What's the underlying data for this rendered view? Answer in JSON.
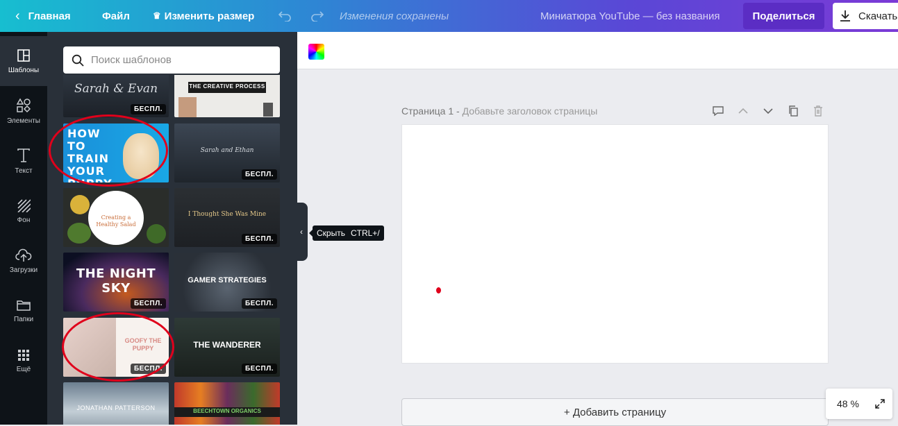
{
  "topbar": {
    "home": "Главная",
    "file": "Файл",
    "resize": "Изменить размер",
    "saved_status": "Изменения сохранены",
    "doc_title": "Миниатюра YouTube — без названия",
    "share": "Поделиться",
    "download": "Скачать"
  },
  "nav": {
    "items": [
      {
        "label": "Шаблоны",
        "icon": "templates-icon"
      },
      {
        "label": "Элементы",
        "icon": "elements-icon"
      },
      {
        "label": "Текст",
        "icon": "text-icon"
      },
      {
        "label": "Фон",
        "icon": "background-icon"
      },
      {
        "label": "Загрузки",
        "icon": "uploads-icon"
      },
      {
        "label": "Папки",
        "icon": "folder-icon"
      },
      {
        "label": "Ещё",
        "icon": "more-icon"
      }
    ]
  },
  "panel": {
    "search_placeholder": "Поиск шаблонов",
    "badge": "БЕСПЛ.",
    "templates": [
      {
        "title": "Sarah & Evan"
      },
      {
        "title": "THE CREATIVE PROCESS"
      },
      {
        "title": "HOW TO TRAIN YOUR PUPPY"
      },
      {
        "title": "Sarah and Ethan"
      },
      {
        "title": "Creating a Healthy Salad"
      },
      {
        "title": "I Thought She Was Mine"
      },
      {
        "title": "THE NIGHT SKY"
      },
      {
        "title": "GAMER STRATEGIES"
      },
      {
        "title": "GOOFY THE PUPPY"
      },
      {
        "title": "THE WANDERER"
      },
      {
        "title": "JONATHAN PATTERSON"
      },
      {
        "title": "BEECHTOWN ORGANICS"
      }
    ]
  },
  "collapse_tooltip": {
    "label": "Скрыть",
    "shortcut": "CTRL+/"
  },
  "page": {
    "label": "Страница 1 -",
    "title_placeholder": "Добавьте заголовок страницы",
    "add_page": "+ Добавить страницу"
  },
  "zoom": {
    "level": "48 %"
  },
  "colors": {
    "gradient_start": "#17bed0",
    "gradient_end": "#7b3ad6",
    "share": "#5b2dc4",
    "nav_bg": "#0e1318",
    "panel_bg": "#293039"
  }
}
